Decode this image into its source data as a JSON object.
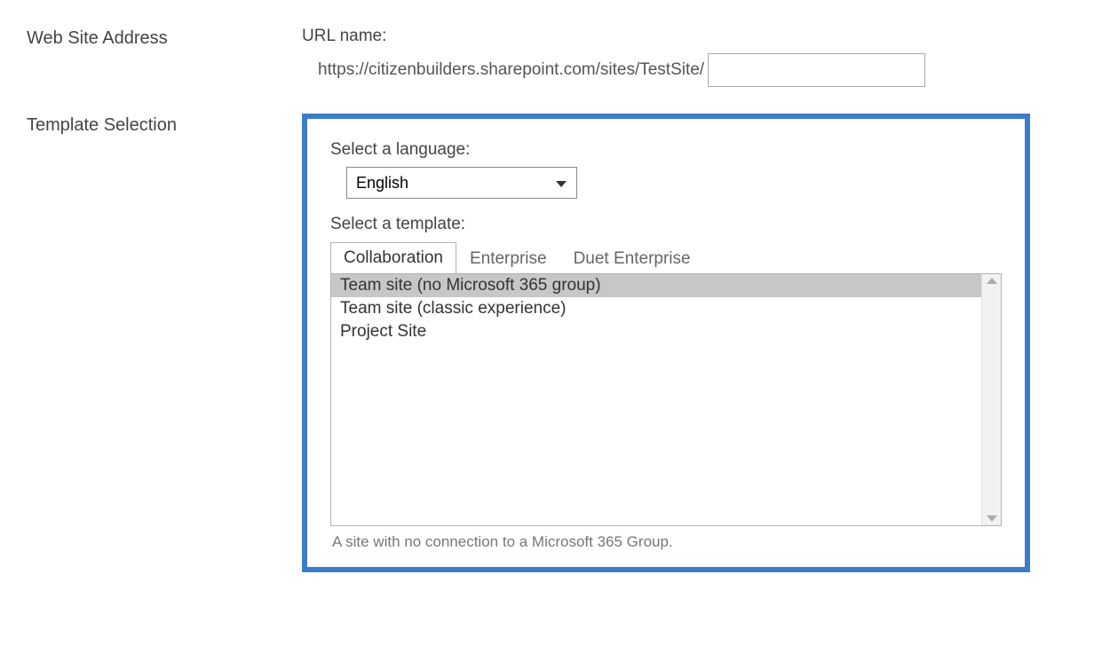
{
  "sections": {
    "webSiteAddress": {
      "label": "Web Site Address",
      "urlNameLabel": "URL name:",
      "urlPrefix": "https://citizenbuilders.sharepoint.com/sites/TestSite/",
      "urlValue": ""
    },
    "templateSelection": {
      "label": "Template Selection",
      "languageLabel": "Select a language:",
      "languageValue": "English",
      "templateLabel": "Select a template:",
      "tabs": [
        {
          "label": "Collaboration",
          "active": true
        },
        {
          "label": "Enterprise",
          "active": false
        },
        {
          "label": "Duet Enterprise",
          "active": false
        }
      ],
      "options": [
        {
          "label": "Team site (no Microsoft 365 group)",
          "selected": true
        },
        {
          "label": "Team site (classic experience)",
          "selected": false
        },
        {
          "label": "Project Site",
          "selected": false
        }
      ],
      "description": "A site with no connection to a Microsoft 365 Group."
    }
  }
}
